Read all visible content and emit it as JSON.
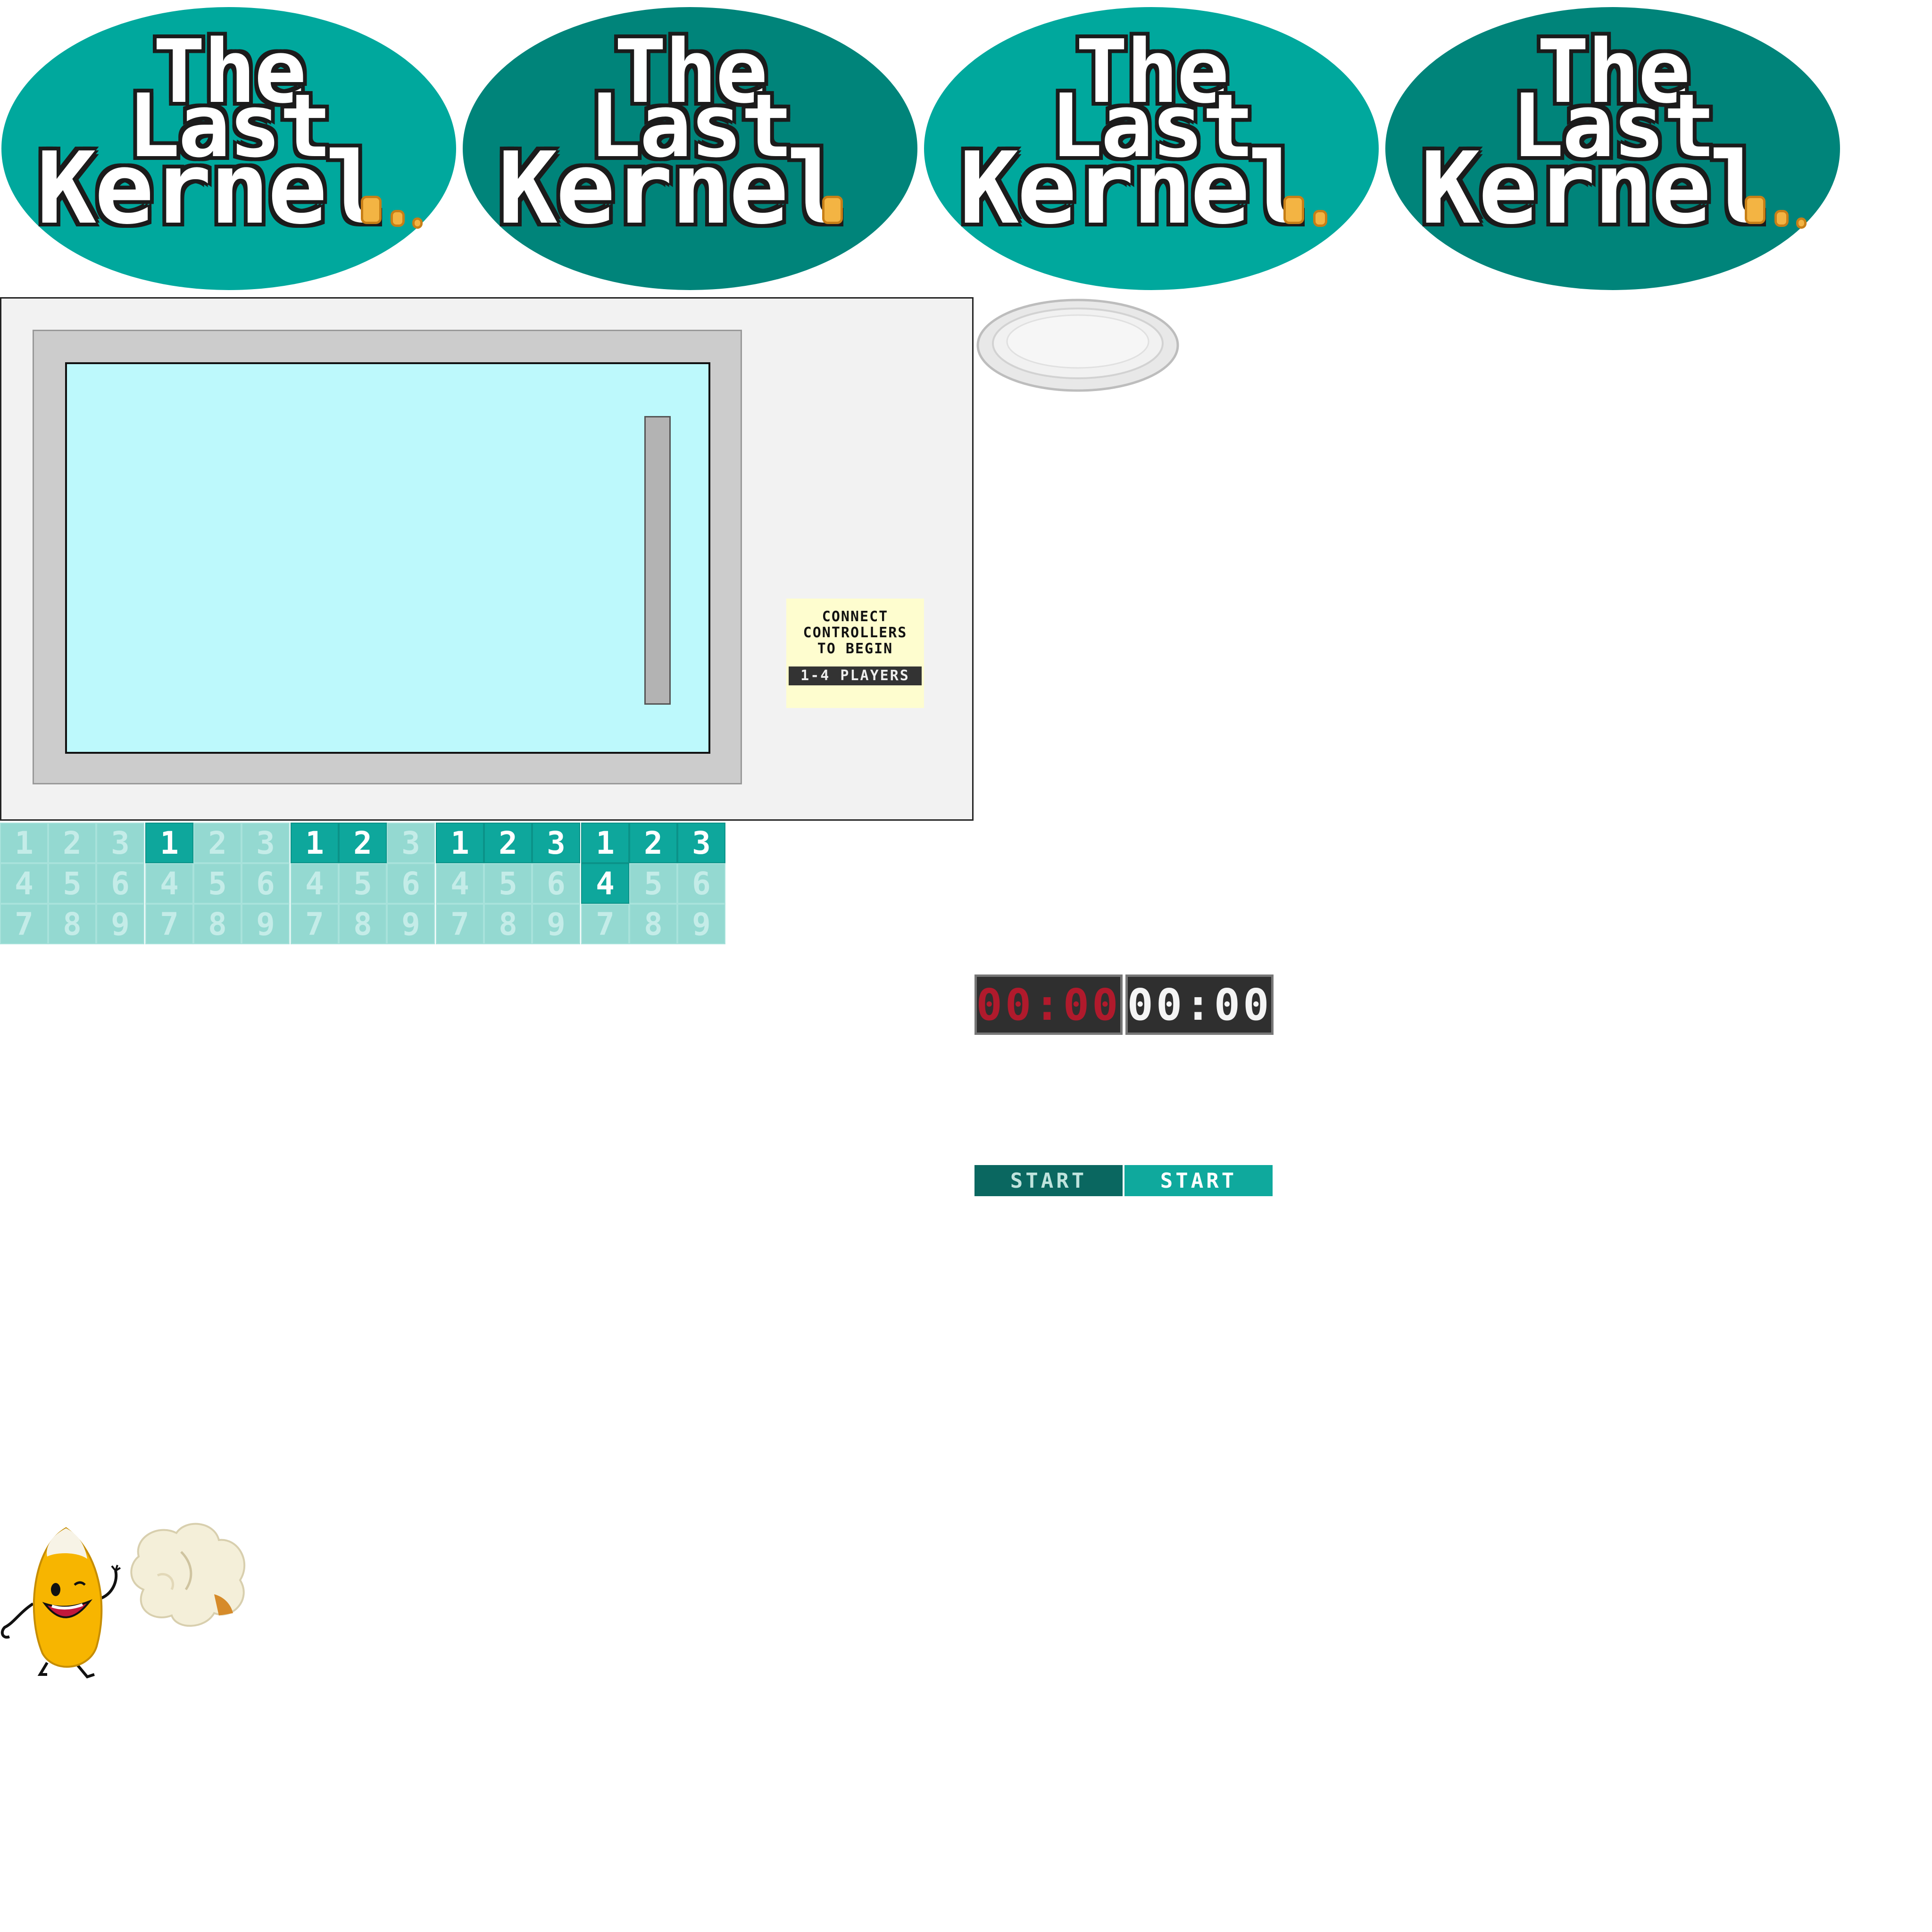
{
  "logos": [
    {
      "line1": "The",
      "line2": "Last",
      "line3": "Kernel",
      "color": "#00a89d"
    },
    {
      "line1": "The",
      "line2": "Last",
      "line3": "Kernel",
      "color": "#00847a"
    },
    {
      "line1": "The",
      "line2": "Last",
      "line3": "Kernel",
      "color": "#00a89d"
    },
    {
      "line1": "The",
      "line2": "Last",
      "line3": "Kernel",
      "color": "#00847a"
    }
  ],
  "microwave": {
    "notice": {
      "line1": "CONNECT",
      "line2": "CONTROLLERS",
      "line3": "TO BEGIN",
      "players": "1-4 PLAYERS"
    }
  },
  "keypads": [
    {
      "keys": [
        "1",
        "2",
        "3",
        "4",
        "5",
        "6",
        "7",
        "8",
        "9"
      ],
      "active": []
    },
    {
      "keys": [
        "1",
        "2",
        "3",
        "4",
        "5",
        "6",
        "7",
        "8",
        "9"
      ],
      "active": [
        "1"
      ]
    },
    {
      "keys": [
        "1",
        "2",
        "3",
        "4",
        "5",
        "6",
        "7",
        "8",
        "9"
      ],
      "active": [
        "1",
        "2"
      ]
    },
    {
      "keys": [
        "1",
        "2",
        "3",
        "4",
        "5",
        "6",
        "7",
        "8",
        "9"
      ],
      "active": [
        "1",
        "2",
        "3"
      ]
    },
    {
      "keys": [
        "1",
        "2",
        "3",
        "4",
        "5",
        "6",
        "7",
        "8",
        "9"
      ],
      "active": [
        "1",
        "2",
        "3",
        "4"
      ]
    }
  ],
  "timers": {
    "red": "00:00",
    "white": "00:00"
  },
  "buttons": {
    "start_dark": "START",
    "start_light": "START"
  },
  "colors": {
    "teal": "#0ea79c",
    "teal_dark": "#0a6760",
    "key_inactive": "#94d9d1",
    "window": "#bdf9fc",
    "notice": "#fefdcf",
    "timer_red": "#b01a2c"
  }
}
